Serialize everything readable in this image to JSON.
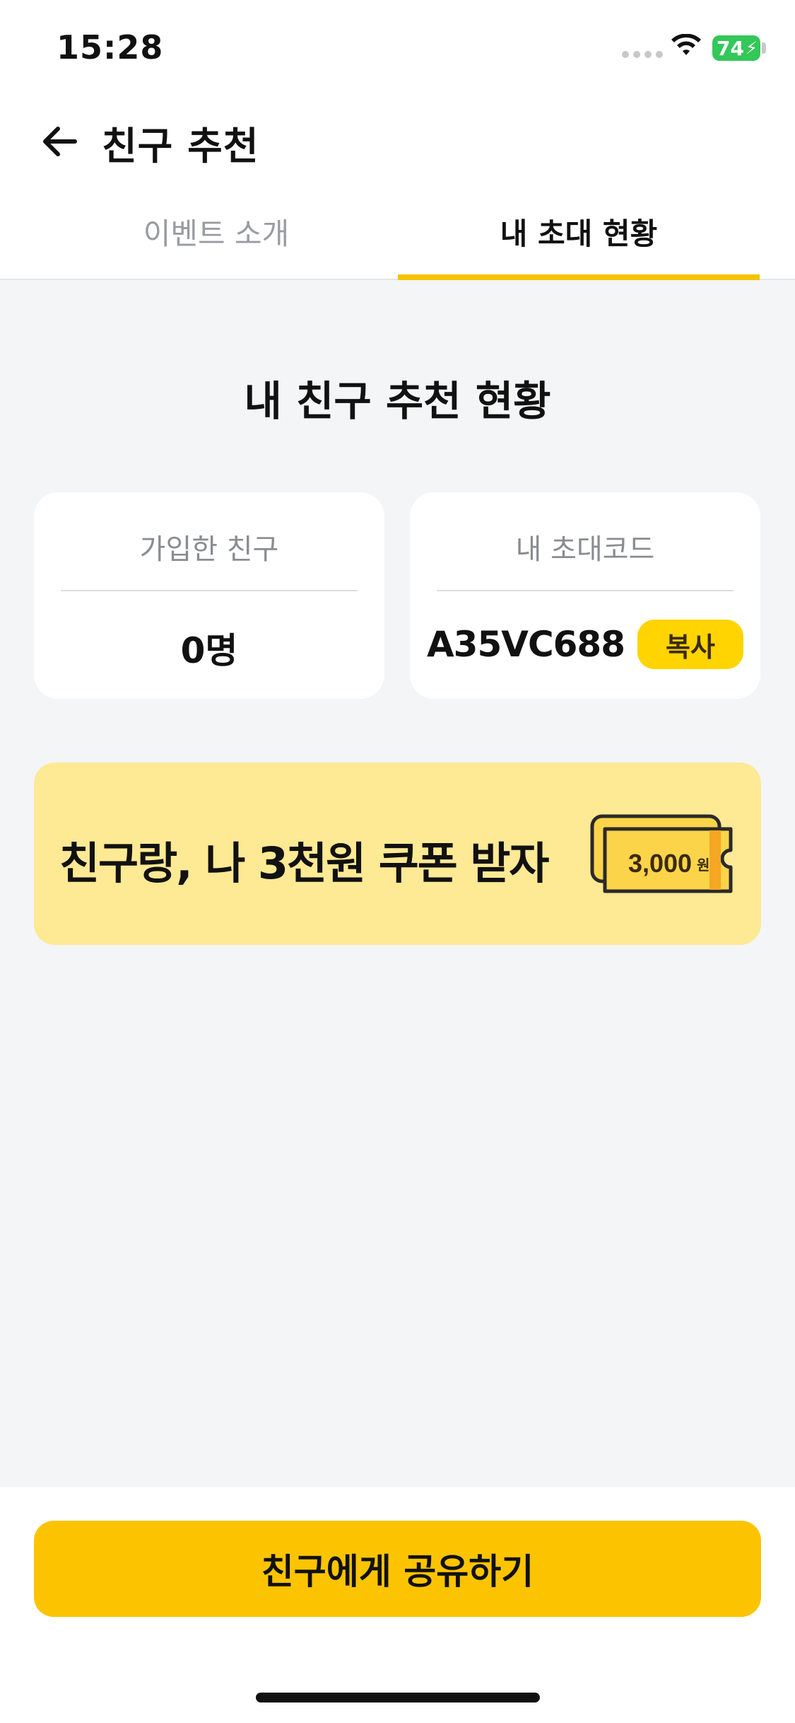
{
  "status_bar": {
    "time": "15:28",
    "battery_level": "74",
    "icons": [
      "signal-icon",
      "wifi-icon",
      "battery-charging-icon"
    ]
  },
  "header": {
    "back_icon": "arrow-left-icon",
    "title": "친구 추천"
  },
  "tabs": [
    {
      "label": "이벤트 소개",
      "selected": false
    },
    {
      "label": "내 초대 현황",
      "selected": true
    }
  ],
  "main": {
    "section_title": "내 친구 추천 현황",
    "friends_card": {
      "label": "가입한 친구",
      "value": "0명"
    },
    "code_card": {
      "label": "내 초대코드",
      "code": "A35VC688",
      "copy_label": "복사"
    },
    "banner": {
      "text": "친구랑, 나 3천원 쿠폰 받자",
      "coupon_amount": "3,000",
      "coupon_unit": "원"
    }
  },
  "footer": {
    "share_label": "친구에게 공유하기"
  },
  "colors": {
    "accent": "#fcc400",
    "banner_bg": "#fee994",
    "page_bg": "#f4f5f7",
    "battery": "#34c759"
  }
}
